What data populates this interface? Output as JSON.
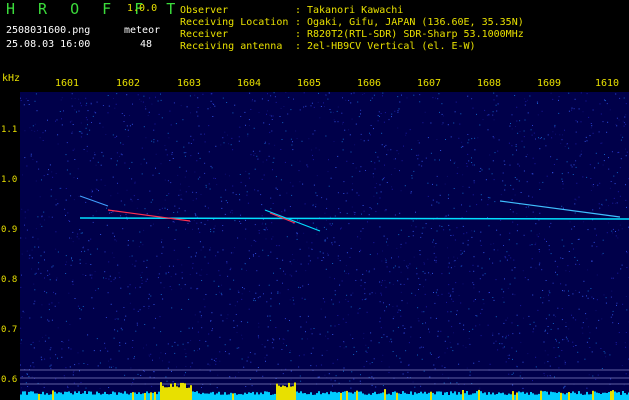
{
  "app": {
    "name": "H R O F F T",
    "version": "1.0.0",
    "filename": "2508031600.png",
    "datetime": "25.08.03 16:00",
    "meteor_label": "meteor",
    "meteor_count": "48"
  },
  "info": {
    "labels": [
      "Observer",
      "Receiving Location",
      "Receiver",
      "Receiving antenna"
    ],
    "colon": ":",
    "values": [
      "Takanori Kawachi",
      "Ogaki, Gifu, JAPAN (136.60E, 35.35N)",
      "R820T2(RTL-SDR) SDR-Sharp 53.1000MHz",
      "2el-HB9CV Vertical (el. E-W)"
    ]
  },
  "axes": {
    "freq_unit": "kHz",
    "time_ticks": [
      "1601",
      "1602",
      "1603",
      "1604",
      "1605",
      "1606",
      "1607",
      "1608",
      "1609",
      "1610"
    ],
    "freq_ticks": [
      "1.1",
      "1.0",
      "0.9",
      "0.8",
      "0.7",
      "0.6"
    ]
  },
  "colors": {
    "background": "#000000",
    "logo": "#3bdc3b",
    "axis_text": "#e8e000",
    "noise_base": "#00004a",
    "carrier": "#00e0ff",
    "echo": "#ff3050",
    "signal_bar": "#e8e000",
    "noise_bar": "#00ccff"
  },
  "icons": [
    "hroft-logo"
  ]
}
